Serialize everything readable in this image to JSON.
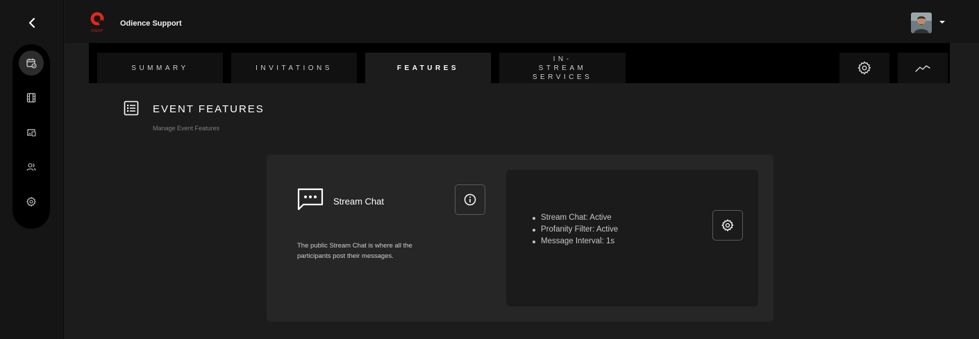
{
  "topbar": {
    "app_title": "Odience Support",
    "logo_text": "DIENT"
  },
  "left_rail": {
    "items": [
      {
        "icon": "calendar-check-icon",
        "active": true
      },
      {
        "icon": "film-icon",
        "active": false
      },
      {
        "icon": "devices-icon",
        "active": false
      },
      {
        "icon": "users-icon",
        "active": false
      },
      {
        "icon": "gear-icon",
        "active": false
      }
    ]
  },
  "tabs": [
    {
      "label": "SUMMARY",
      "active": false
    },
    {
      "label": "INVITATIONS",
      "active": false
    },
    {
      "label": "FEATURES",
      "active": true
    },
    {
      "label": "IN-STREAM SERVICES",
      "active": false
    }
  ],
  "tab_icons": [
    "gear-icon",
    "trend-line-icon"
  ],
  "section": {
    "title": "EVENT FEATURES",
    "subtitle": "Manage Event Features"
  },
  "feature": {
    "name": "Stream Chat",
    "description": "The public Stream Chat is where all the participants post their messages.",
    "status": [
      "Stream Chat: Active",
      "Profanity Filter: Active",
      "Message Interval: 1s"
    ]
  },
  "colors": {
    "background": "#1c1c1c",
    "rail": "#151515",
    "card": "#262626",
    "panel": "#1b1b1b",
    "brand_red": "#e1261c"
  }
}
